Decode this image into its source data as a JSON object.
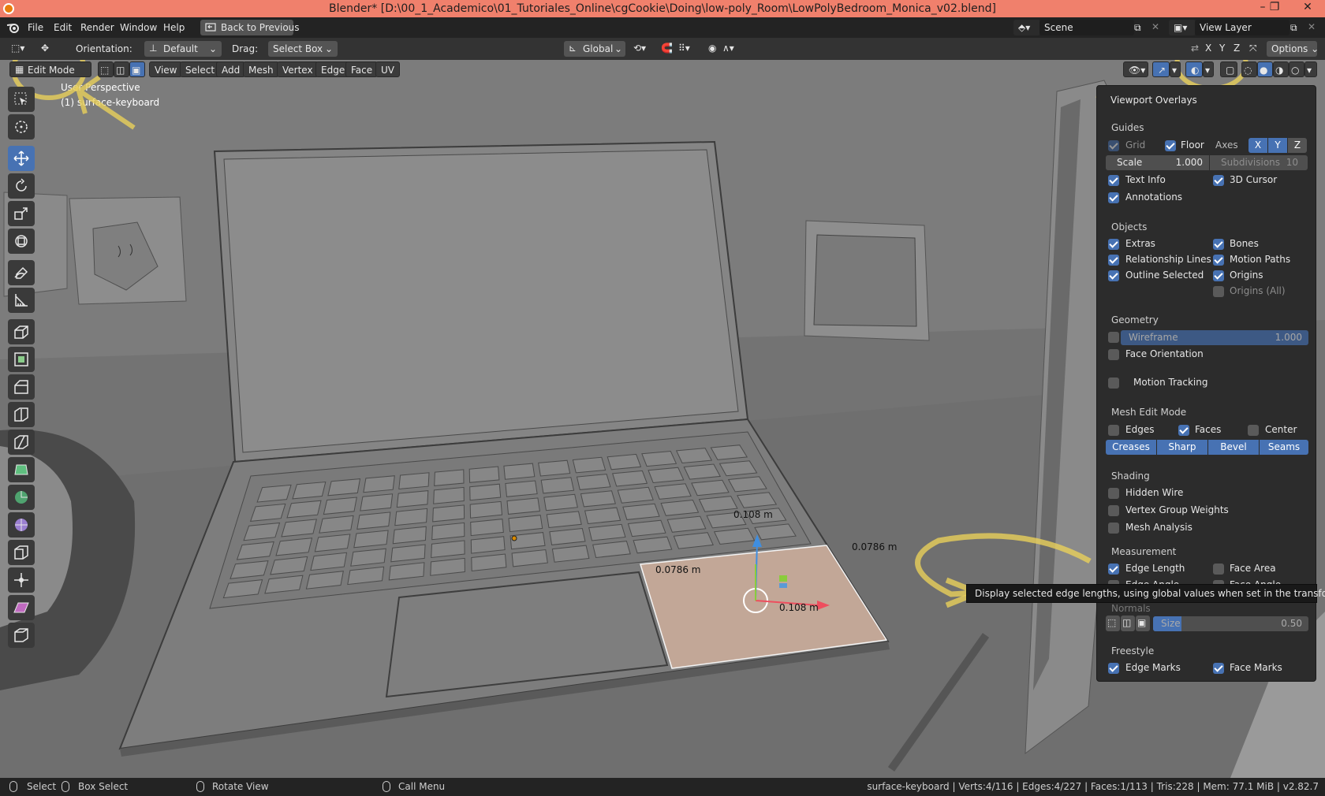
{
  "window": {
    "title": "Blender* [D:\\00_1_Academico\\01_Tutoriales_Online\\cgCookie\\Doing\\low-poly_Room\\LowPolyBedroom_Monica_v02.blend]",
    "minimize": "–",
    "maximize": "❐",
    "close": "✕"
  },
  "menubar": {
    "items": [
      "File",
      "Edit",
      "Render",
      "Window",
      "Help"
    ],
    "back_button": "Back to Previous",
    "scene_label": "Scene",
    "view_layer_label": "View Layer"
  },
  "toolheader": {
    "orientation_label": "Orientation:",
    "orientation_value": "Default",
    "drag_label": "Drag:",
    "drag_value": "Select Box",
    "transform_orientation": "Global",
    "options_label": "Options"
  },
  "viewport_header": {
    "mode": "Edit Mode",
    "menus": [
      "View",
      "Select",
      "Add",
      "Mesh",
      "Vertex",
      "Edge",
      "Face",
      "UV"
    ]
  },
  "viewport": {
    "perspective_label": "User Perspective",
    "object_label": "(1) surface-keyboard",
    "axis_x": "X",
    "axis_y": "Y",
    "axis_z": "Z",
    "measurements": {
      "top": "0.108 m",
      "bottom": "0.108 m",
      "left": "0.0786 m",
      "right": "0.0786 m"
    }
  },
  "overlays_panel": {
    "title": "Viewport Overlays",
    "guides": {
      "heading": "Guides",
      "grid": "Grid",
      "floor": "Floor",
      "axes": "Axes",
      "axis_x": "X",
      "axis_y": "Y",
      "axis_z": "Z",
      "scale_label": "Scale",
      "scale_value": "1.000",
      "subdivisions_label": "Subdivisions",
      "subdivisions_value": "10",
      "text_info": "Text Info",
      "cursor_3d": "3D Cursor",
      "annotations": "Annotations"
    },
    "objects": {
      "heading": "Objects",
      "extras": "Extras",
      "bones": "Bones",
      "relationship_lines": "Relationship Lines",
      "motion_paths": "Motion Paths",
      "outline_selected": "Outline Selected",
      "origins": "Origins",
      "origins_all": "Origins (All)"
    },
    "geometry": {
      "heading": "Geometry",
      "wireframe_label": "Wireframe",
      "wireframe_value": "1.000",
      "face_orientation": "Face Orientation",
      "motion_tracking": "Motion Tracking"
    },
    "mesh_edit": {
      "heading": "Mesh Edit Mode",
      "edges": "Edges",
      "faces": "Faces",
      "center": "Center",
      "creases": "Creases",
      "sharp": "Sharp",
      "bevel": "Bevel",
      "seams": "Seams"
    },
    "shading": {
      "heading": "Shading",
      "hidden_wire": "Hidden Wire",
      "vertex_group_weights": "Vertex Group Weights",
      "mesh_analysis": "Mesh Analysis"
    },
    "measurement": {
      "heading": "Measurement",
      "edge_length": "Edge Length",
      "face_area": "Face Area",
      "edge_angle": "Edge Angle",
      "face_angle": "Face Angle"
    },
    "normals": {
      "heading": "Normals",
      "size_label": "Size",
      "size_value": "0.50"
    },
    "freestyle": {
      "heading": "Freestyle",
      "edge_marks": "Edge Marks",
      "face_marks": "Face Marks"
    }
  },
  "tooltip": "Display selected edge lengths, using global values when set in the transform panel.",
  "statusbar": {
    "select": "Select",
    "box_select": "Box Select",
    "rotate_view": "Rotate View",
    "call_menu": "Call Menu",
    "stats": "surface-keyboard | Verts:4/116 | Edges:4/227 | Faces:1/113 | Tris:228 | Mem: 77.1 MiB | v2.82.7"
  }
}
